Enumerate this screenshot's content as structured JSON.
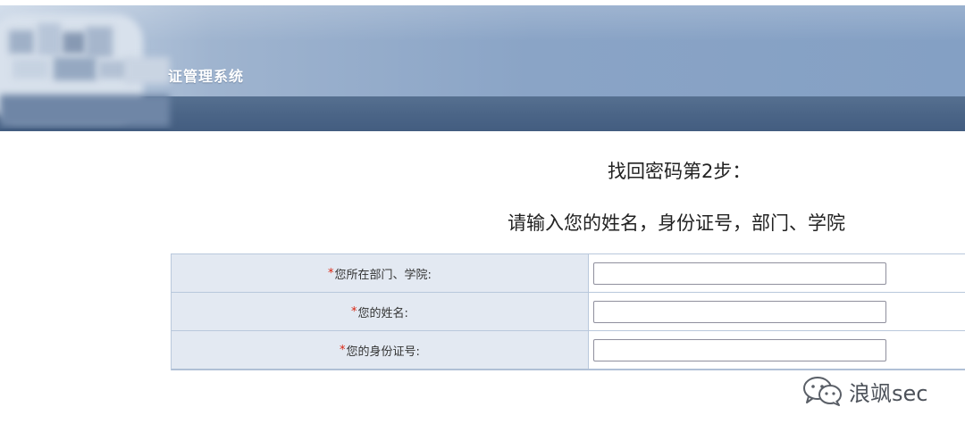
{
  "header": {
    "system_title": "证管理系统"
  },
  "step": {
    "title": "找回密码第2步：",
    "instruction": "请输入您的姓名，身份证号，部门、学院"
  },
  "form": {
    "fields": [
      {
        "required": "*",
        "label": "您所在部门、学院:",
        "value": ""
      },
      {
        "required": "*",
        "label": "您的姓名:",
        "value": ""
      },
      {
        "required": "*",
        "label": "您的身份证号:",
        "value": ""
      }
    ]
  },
  "watermark": {
    "icon": "wechat-icon",
    "text": "浪飒sec"
  },
  "colors": {
    "header_band": "#8aa4c6",
    "header_bar": "#4b6587",
    "label_cell_bg": "#e3e9f2",
    "table_border": "#b9c8dc",
    "required_mark": "#d9230f"
  }
}
